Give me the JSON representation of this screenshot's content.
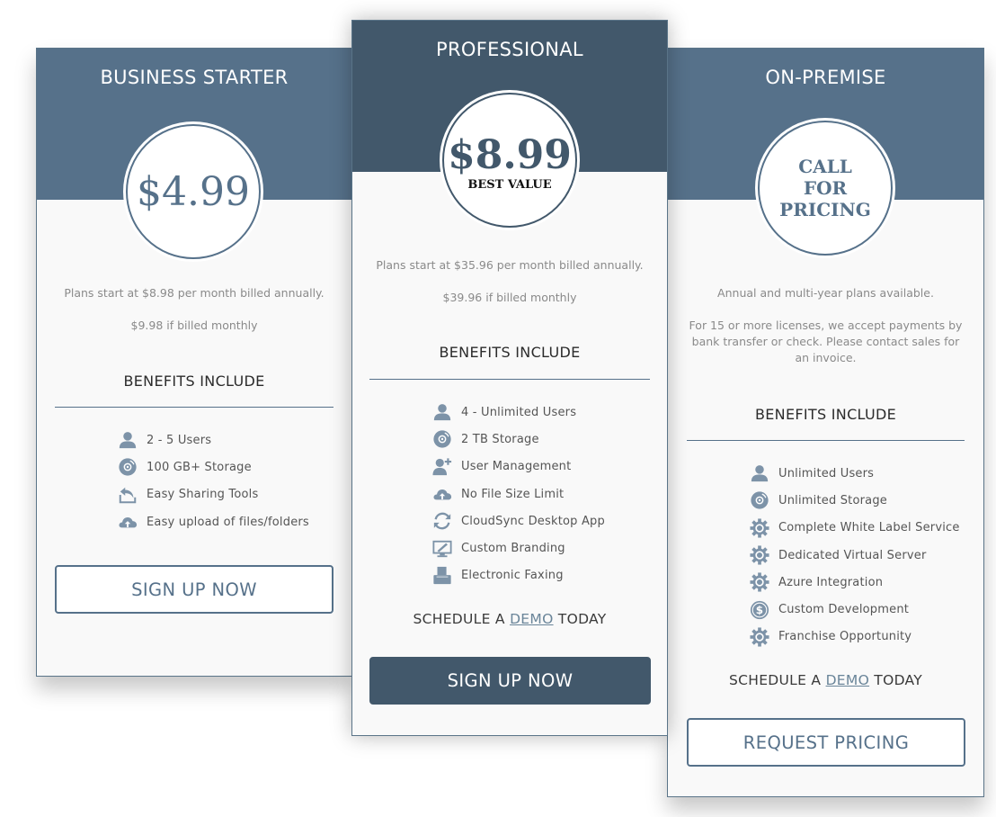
{
  "colors": {
    "header_light": "#56718a",
    "header_dark": "#42586b",
    "card_bg": "#f9f9f9",
    "icon": "#7d93a8"
  },
  "plans": [
    {
      "title": "BUSINESS STARTER",
      "price": "$4.99",
      "desc_lines": [
        "Plans start at $8.98 per month billed annually.",
        "$9.98 if billed monthly"
      ],
      "benefits_title": "BENEFITS INCLUDE",
      "features": [
        {
          "icon": "user-icon",
          "label": "2 - 5 Users"
        },
        {
          "icon": "disc-icon",
          "label": "100 GB+ Storage"
        },
        {
          "icon": "share-icon",
          "label": "Easy Sharing Tools"
        },
        {
          "icon": "cloud-upload-icon",
          "label": "Easy upload of files/folders"
        }
      ],
      "button_label": "SIGN UP NOW"
    },
    {
      "title": "PROFESSIONAL",
      "price": "$8.99",
      "badge": "BEST VALUE",
      "desc_lines": [
        "Plans start at $35.96 per month billed annually.",
        "$39.96 if billed monthly"
      ],
      "benefits_title": "BENEFITS INCLUDE",
      "features": [
        {
          "icon": "user-icon",
          "label": "4 - Unlimited Users"
        },
        {
          "icon": "disc-icon",
          "label": "2 TB Storage"
        },
        {
          "icon": "user-add-icon",
          "label": "User Management"
        },
        {
          "icon": "cloud-upload-icon",
          "label": "No File Size Limit"
        },
        {
          "icon": "sync-icon",
          "label": "CloudSync Desktop App"
        },
        {
          "icon": "monitor-edit-icon",
          "label": "Custom Branding"
        },
        {
          "icon": "fax-icon",
          "label": "Electronic Faxing"
        }
      ],
      "demo": {
        "prefix": "SCHEDULE A ",
        "link": "DEMO",
        "suffix": " TODAY"
      },
      "button_label": "SIGN UP NOW"
    },
    {
      "title": "ON-PREMISE",
      "price_lines": [
        "CALL",
        "FOR",
        "PRICING"
      ],
      "desc_lines": [
        "Annual and multi-year plans available.",
        "For 15 or more licenses, we accept payments by bank transfer or check. Please contact sales for an invoice."
      ],
      "benefits_title": "BENEFITS INCLUDE",
      "features": [
        {
          "icon": "user-icon",
          "label": "Unlimited Users"
        },
        {
          "icon": "disc-icon",
          "label": "Unlimited Storage"
        },
        {
          "icon": "gear-icon",
          "label": "Complete White Label Service"
        },
        {
          "icon": "gear-icon",
          "label": "Dedicated Virtual Server"
        },
        {
          "icon": "gear-icon",
          "label": "Azure Integration"
        },
        {
          "icon": "dollar-coin-icon",
          "label": "Custom Development"
        },
        {
          "icon": "gear-icon",
          "label": "Franchise Opportunity"
        }
      ],
      "demo": {
        "prefix": "SCHEDULE A ",
        "link": "DEMO",
        "suffix": " TODAY"
      },
      "button_label": "REQUEST PRICING"
    }
  ]
}
